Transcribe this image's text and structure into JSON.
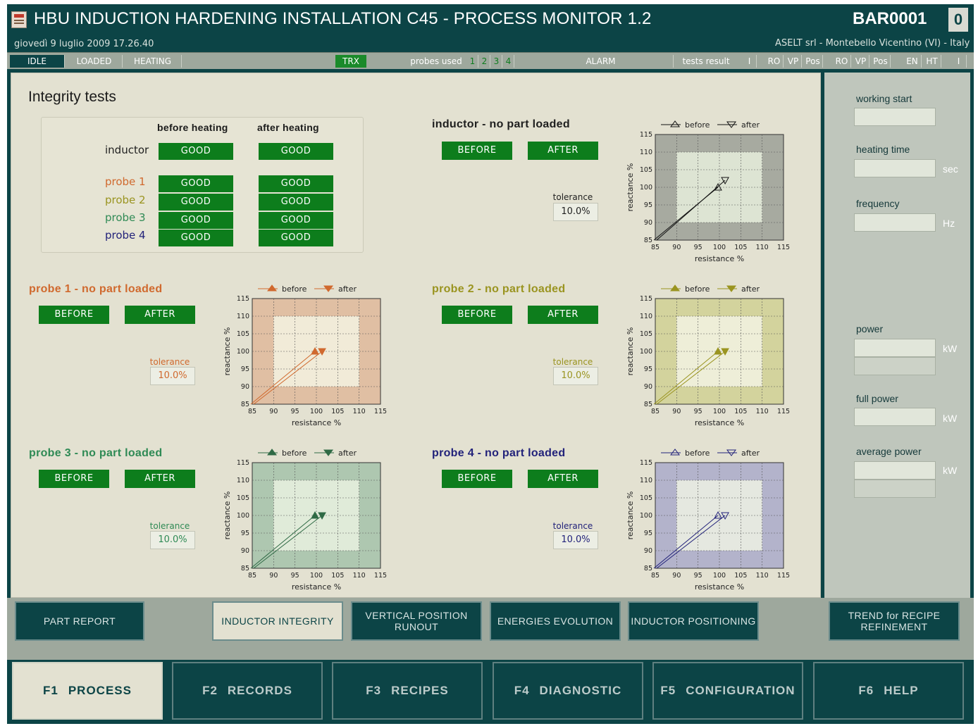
{
  "header": {
    "title": "HBU INDUCTION HARDENING INSTALLATION C45 - PROCESS MONITOR 1.2",
    "station_id": "BAR0001",
    "counter": "0",
    "datetime": "giovedì 9 luglio 2009 17.26.40",
    "company": "ASELT srl  - Montebello Vicentino (VI) - Italy"
  },
  "statusbar": {
    "idle": "IDLE",
    "loaded": "LOADED",
    "heating": "HEATING",
    "trx": "TRX",
    "probes_used_label": "probes used",
    "probes": [
      "1",
      "2",
      "3",
      "4"
    ],
    "alarm": "ALARM",
    "tests_result_label": "tests result",
    "result_fields": [
      "I",
      "RO",
      "VP",
      "Pos",
      "RO",
      "VP",
      "Pos",
      "EN",
      "HT",
      "I"
    ]
  },
  "integrity": {
    "title": "Integrity tests",
    "col_before": "before heating",
    "col_after": "after heating",
    "rows": [
      {
        "label": "inductor",
        "before": "GOOD",
        "after": "GOOD",
        "color": "#1f1f1f"
      },
      {
        "label": "probe 1",
        "before": "GOOD",
        "after": "GOOD",
        "color": "#d0692e"
      },
      {
        "label": "probe 2",
        "before": "GOOD",
        "after": "GOOD",
        "color": "#9a9420"
      },
      {
        "label": "probe 3",
        "before": "GOOD",
        "after": "GOOD",
        "color": "#2f8a55"
      },
      {
        "label": "probe 4",
        "before": "GOOD",
        "after": "GOOD",
        "color": "#22227a"
      }
    ]
  },
  "panels": [
    {
      "title": "inductor - no part loaded",
      "title_color": "#1f1f1f",
      "before_btn": "BEFORE",
      "after_btn": "AFTER",
      "tolerance_label": "tolerance",
      "tolerance": "10.0%",
      "tol_color": "#1f1f1f",
      "bg": "#a7aaa0",
      "inner": "#dde4d3",
      "line": "#111111"
    },
    {
      "title": "probe 1 - no part loaded",
      "title_color": "#d0692e",
      "before_btn": "BEFORE",
      "after_btn": "AFTER",
      "tolerance_label": "tolerance",
      "tolerance": "10.0%",
      "tol_color": "#d0692e",
      "bg": "#e0bfa3",
      "inner": "#f1ebd8",
      "line": "#d0692e"
    },
    {
      "title": "probe 2 - no part loaded",
      "title_color": "#9a9420",
      "before_btn": "BEFORE",
      "after_btn": "AFTER",
      "tolerance_label": "tolerance",
      "tolerance": "10.0%",
      "tol_color": "#9a9420",
      "bg": "#d3d39d",
      "inner": "#eeeed8",
      "line": "#9a9420"
    },
    {
      "title": "probe 3 - no part loaded",
      "title_color": "#2f8a55",
      "before_btn": "BEFORE",
      "after_btn": "AFTER",
      "tolerance_label": "tolerance",
      "tolerance": "10.0%",
      "tol_color": "#2f8a55",
      "bg": "#aec7b0",
      "inner": "#e0ebd9",
      "line": "#2f6a45"
    },
    {
      "title": "probe 4 - no part loaded",
      "title_color": "#22227a",
      "before_btn": "BEFORE",
      "after_btn": "AFTER",
      "tolerance_label": "tolerance",
      "tolerance": "10.0%",
      "tol_color": "#22227a",
      "bg": "#b3b3cb",
      "inner": "#e5e8e0",
      "line": "#22227a"
    }
  ],
  "chart_data": [
    {
      "type": "line",
      "panel": "inductor",
      "legend": [
        "before",
        "after"
      ],
      "xlabel": "resistance %",
      "ylabel": "reactance %",
      "xlim": [
        85,
        115
      ],
      "ylim": [
        85,
        115
      ],
      "ticks": [
        "85",
        "90",
        "95",
        "100",
        "105",
        "110",
        "115"
      ],
      "tolerance_band": [
        90,
        110
      ],
      "series": [
        {
          "name": "before",
          "x": [
            85,
            100
          ],
          "y": [
            85,
            100
          ]
        },
        {
          "name": "after",
          "x": [
            85,
            101
          ],
          "y": [
            85,
            102
          ]
        }
      ]
    },
    {
      "type": "line",
      "panel": "probe 1",
      "legend": [
        "before",
        "after"
      ],
      "xlabel": "resistance %",
      "ylabel": "reactance %",
      "xlim": [
        85,
        115
      ],
      "ylim": [
        85,
        115
      ],
      "ticks": [
        "85",
        "90",
        "95",
        "100",
        "105",
        "110",
        "115"
      ],
      "tolerance_band": [
        90,
        110
      ],
      "series": [
        {
          "name": "before",
          "x": [
            85,
            100
          ],
          "y": [
            85,
            100
          ]
        },
        {
          "name": "after",
          "x": [
            85,
            101
          ],
          "y": [
            85,
            100
          ]
        }
      ]
    },
    {
      "type": "line",
      "panel": "probe 2",
      "legend": [
        "before",
        "after"
      ],
      "xlabel": "resistance %",
      "ylabel": "reactance %",
      "xlim": [
        85,
        115
      ],
      "ylim": [
        85,
        115
      ],
      "ticks": [
        "85",
        "90",
        "95",
        "100",
        "105",
        "110",
        "115"
      ],
      "tolerance_band": [
        90,
        110
      ],
      "series": [
        {
          "name": "before",
          "x": [
            85,
            100
          ],
          "y": [
            85,
            100
          ]
        },
        {
          "name": "after",
          "x": [
            85,
            101
          ],
          "y": [
            85,
            100
          ]
        }
      ]
    },
    {
      "type": "line",
      "panel": "probe 3",
      "legend": [
        "before",
        "after"
      ],
      "xlabel": "resistance %",
      "ylabel": "reactance %",
      "xlim": [
        85,
        115
      ],
      "ylim": [
        85,
        115
      ],
      "ticks": [
        "85",
        "90",
        "95",
        "100",
        "105",
        "110",
        "115"
      ],
      "tolerance_band": [
        90,
        110
      ],
      "series": [
        {
          "name": "before",
          "x": [
            85,
            100
          ],
          "y": [
            85,
            100
          ]
        },
        {
          "name": "after",
          "x": [
            85,
            101
          ],
          "y": [
            85,
            100
          ]
        }
      ]
    },
    {
      "type": "line",
      "panel": "probe 4",
      "legend": [
        "before",
        "after"
      ],
      "xlabel": "resistance %",
      "ylabel": "reactance %",
      "xlim": [
        85,
        115
      ],
      "ylim": [
        85,
        115
      ],
      "ticks": [
        "85",
        "90",
        "95",
        "100",
        "105",
        "110",
        "115"
      ],
      "tolerance_band": [
        90,
        110
      ],
      "series": [
        {
          "name": "before",
          "x": [
            85,
            100
          ],
          "y": [
            85,
            100
          ]
        },
        {
          "name": "after",
          "x": [
            85,
            101
          ],
          "y": [
            85,
            100
          ]
        }
      ]
    }
  ],
  "side": {
    "working_start": "working start",
    "heating_time": "heating time",
    "sec": "sec",
    "frequency": "frequency",
    "hz": "Hz",
    "power": "power",
    "kw": "kW",
    "full_power": "full power",
    "average_power": "average power"
  },
  "nav": {
    "part_report": "PART REPORT",
    "inductor_integrity": "INDUCTOR INTEGRITY",
    "vertical_runout_1": "VERTICAL POSITION",
    "vertical_runout_2": "RUNOUT",
    "energies": "ENERGIES  EVOLUTION",
    "inductor_pos": "INDUCTOR POSITIONING",
    "trend_1": "TREND for RECIPE",
    "trend_2": "REFINEMENT"
  },
  "fkeys": [
    {
      "key": "F1",
      "label": "PROCESS"
    },
    {
      "key": "F2",
      "label": "RECORDS"
    },
    {
      "key": "F3",
      "label": "RECIPES"
    },
    {
      "key": "F4",
      "label": "DIAGNOSTIC"
    },
    {
      "key": "F5",
      "label": "CONFIGURATION"
    },
    {
      "key": "F6",
      "label": "HELP"
    }
  ]
}
